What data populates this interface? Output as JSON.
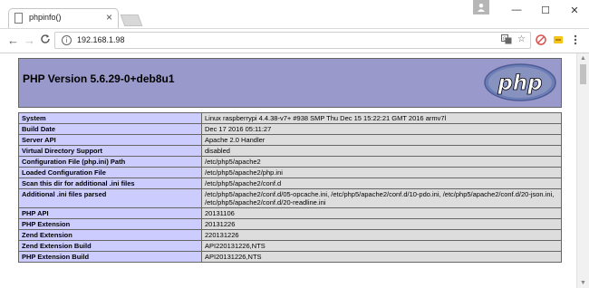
{
  "browser": {
    "tab_title": "phpinfo()",
    "tab_close": "×",
    "url": "192.168.1.98",
    "window_controls": {
      "minimize": "—",
      "maximize": "☐",
      "close": "✕"
    },
    "nav": {
      "back": "←",
      "forward": "→",
      "reload": "C"
    },
    "icons": {
      "translate": "translate-icon",
      "star": "star-icon",
      "menu": "more-vert-icon"
    }
  },
  "page": {
    "header_title": "PHP Version 5.6.29-0+deb8u1",
    "logo_text": "php",
    "rows": [
      {
        "label": "System",
        "value": "Linux raspberrypi 4.4.38-v7+ #938 SMP Thu Dec 15 15:22:21 GMT 2016 armv7l"
      },
      {
        "label": "Build Date",
        "value": "Dec 17 2016 05:11:27"
      },
      {
        "label": "Server API",
        "value": "Apache 2.0 Handler"
      },
      {
        "label": "Virtual Directory Support",
        "value": "disabled"
      },
      {
        "label": "Configuration File (php.ini) Path",
        "value": "/etc/php5/apache2"
      },
      {
        "label": "Loaded Configuration File",
        "value": "/etc/php5/apache2/php.ini"
      },
      {
        "label": "Scan this dir for additional .ini files",
        "value": "/etc/php5/apache2/conf.d"
      },
      {
        "label": "Additional .ini files parsed",
        "value": "/etc/php5/apache2/conf.d/05-opcache.ini, /etc/php5/apache2/conf.d/10-pdo.ini, /etc/php5/apache2/conf.d/20-json.ini, /etc/php5/apache2/conf.d/20-readline.ini"
      },
      {
        "label": "PHP API",
        "value": "20131106"
      },
      {
        "label": "PHP Extension",
        "value": "20131226"
      },
      {
        "label": "Zend Extension",
        "value": "220131226"
      },
      {
        "label": "Zend Extension Build",
        "value": "API220131226,NTS"
      },
      {
        "label": "PHP Extension Build",
        "value": "API20131226,NTS"
      }
    ]
  },
  "colors": {
    "header_bg": "#9999cc",
    "label_bg": "#ccccff",
    "value_bg": "#dddddd"
  }
}
